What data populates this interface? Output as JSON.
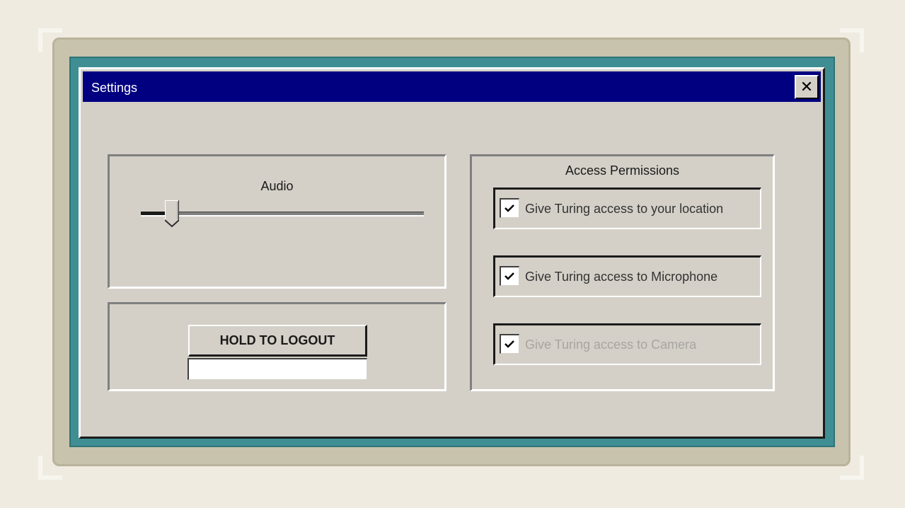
{
  "dialog": {
    "title": "Settings",
    "close_symbol": "✕",
    "close_icon": "close-icon"
  },
  "audio": {
    "label": "Audio",
    "volume_level": 0.11
  },
  "logout": {
    "button_label": "HOLD TO LOGOUT",
    "hold_progress": 0
  },
  "permissions": {
    "title": "Access Permissions",
    "items": [
      {
        "label": "Give Turing access to your location",
        "checked": true,
        "disabled": false
      },
      {
        "label": "Give Turing access to Microphone",
        "checked": true,
        "disabled": false
      },
      {
        "label": "Give Turing access to Camera",
        "checked": true,
        "disabled": true
      }
    ]
  },
  "colors": {
    "titlebar": "#000080",
    "dialog_face": "#d4d0c8",
    "desktop": "#3f8e93",
    "disabled_text": "#a8a5a0"
  }
}
